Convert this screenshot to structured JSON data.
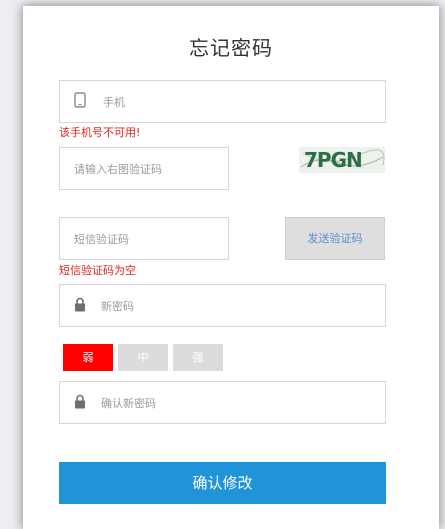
{
  "title": "忘记密码",
  "phone": {
    "placeholder": "手机",
    "error": "该手机号不可用!"
  },
  "captcha": {
    "placeholder": "请输入右图验证码",
    "image_text": "7PGN"
  },
  "sms": {
    "placeholder": "短信验证码",
    "send_label": "发送验证码",
    "error": "短信验证码为空"
  },
  "new_password": {
    "placeholder": "新密码"
  },
  "strength": {
    "weak": "弱",
    "medium": "中",
    "strong": "强",
    "active_color": "#ff0000",
    "inactive_color": "#dcdcdc"
  },
  "confirm_password": {
    "placeholder": "确认新密码"
  },
  "submit_label": "确认修改"
}
